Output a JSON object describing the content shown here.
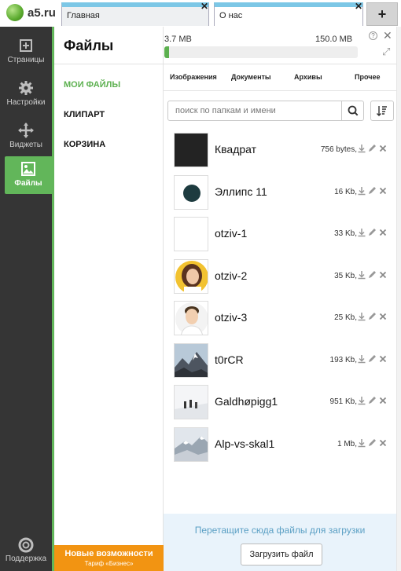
{
  "app": {
    "logo_text": "a5.ru"
  },
  "browser_tabs": [
    {
      "label": "Главная",
      "active": false
    },
    {
      "label": "О нас",
      "active": true
    }
  ],
  "new_tab_label": "+",
  "sidebar": {
    "items": [
      {
        "label": "Страницы",
        "icon": "pages-icon"
      },
      {
        "label": "Настройки",
        "icon": "gear-icon"
      },
      {
        "label": "Виджеты",
        "icon": "move-icon"
      },
      {
        "label": "Файлы",
        "icon": "image-icon",
        "active": true
      }
    ],
    "support_label": "Поддержка"
  },
  "panel": {
    "title": "Файлы",
    "categories": [
      {
        "label": "МОИ ФАЙЛЫ",
        "active": true
      },
      {
        "label": "КЛИПАРТ",
        "active": false
      },
      {
        "label": "КОРЗИНА",
        "active": false
      }
    ],
    "promo": {
      "title": "Новые возможности",
      "subtitle": "Тариф «Бизнес»"
    }
  },
  "storage": {
    "used": "3.7 MB",
    "total": "150.0 MB",
    "used_fraction": 0.025
  },
  "file_tabs": [
    "Изображения",
    "Документы",
    "Архивы",
    "Прочее"
  ],
  "search": {
    "placeholder": "поиск по папкам и имени",
    "value": ""
  },
  "files": [
    {
      "name": "Квадрат",
      "size": "756 bytes,",
      "thumb": "square"
    },
    {
      "name": "Эллипс 11",
      "size": "16 Kb,",
      "thumb": "ellipse"
    },
    {
      "name": "otziv-1",
      "size": "33 Kb,",
      "thumb": "blank"
    },
    {
      "name": "otziv-2",
      "size": "35 Kb,",
      "thumb": "woman"
    },
    {
      "name": "otziv-3",
      "size": "25 Kb,",
      "thumb": "man"
    },
    {
      "name": "t0rCR",
      "size": "193 Kb,",
      "thumb": "mountain"
    },
    {
      "name": "Galdhøpigg1",
      "size": "951 Kb,",
      "thumb": "hikers"
    },
    {
      "name": "Alp-vs-skal1",
      "size": "1 Mb,",
      "thumb": "snowpeak"
    }
  ],
  "dropzone": {
    "text": "Перетащите сюда файлы для загрузки",
    "button": "Загрузить файл"
  },
  "colors": {
    "accent_green": "#5cb04f",
    "sidebar_dark": "#353535",
    "promo_orange": "#f29412",
    "tab_blue": "#7cc7e6"
  }
}
